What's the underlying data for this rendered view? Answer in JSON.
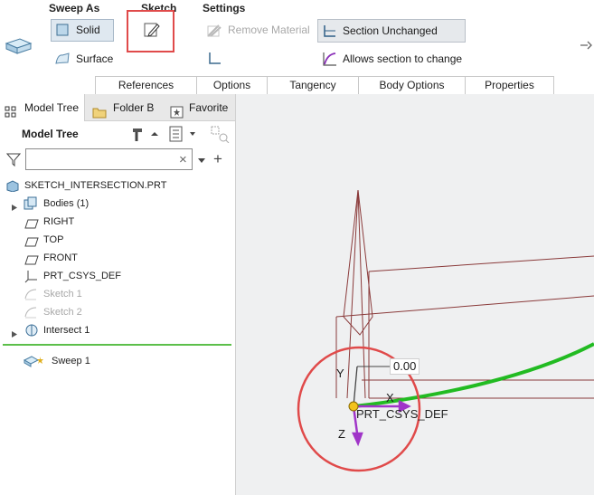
{
  "ribbon": {
    "sweep_as": {
      "title": "Sweep As",
      "solid_label": "Solid",
      "surface_label": "Surface"
    },
    "sketch": {
      "title": "Sketch"
    },
    "settings": {
      "title": "Settings",
      "remove_material_label": "Remove Material",
      "section_unchanged_label": "Section Unchanged",
      "allows_change_label": "Allows section to change"
    },
    "tabs": [
      "References",
      "Options",
      "Tangency",
      "Body Options",
      "Properties"
    ]
  },
  "panel": {
    "tabs": [
      "Model Tree",
      "Folder B",
      "Favorite"
    ],
    "header": "Model Tree",
    "filter": {
      "value": "",
      "clear_glyph": "×"
    }
  },
  "tree": {
    "root": "SKETCH_INTERSECTION.PRT",
    "bodies": "Bodies (1)",
    "right": "RIGHT",
    "top": "TOP",
    "front": "FRONT",
    "csys": "PRT_CSYS_DEF",
    "sketch1": "Sketch 1",
    "sketch2": "Sketch 2",
    "intersect": "Intersect 1",
    "sweep": "Sweep 1"
  },
  "viewport": {
    "dimension": "0.00",
    "csys_label": "PRT_CSYS_DEF",
    "axis_x": "X",
    "axis_y": "Y",
    "axis_z": "Z"
  },
  "colors": {
    "highlight_red": "#e04a4a",
    "trajectory_green": "#22bb22",
    "axis_purple": "#a035c8",
    "wire_brown": "#8a3a3a",
    "separator_green": "#5cbf4a"
  }
}
